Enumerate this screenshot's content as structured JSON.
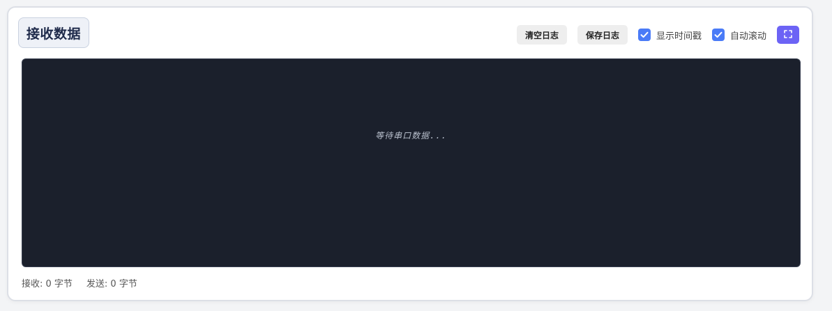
{
  "panel": {
    "title": "接收数据"
  },
  "toolbar": {
    "clear_label": "清空日志",
    "save_label": "保存日志",
    "timestamp_label": "显示时间戳",
    "timestamp_checked": true,
    "autoscroll_label": "自动滚动",
    "autoscroll_checked": true,
    "expand_icon": "fullscreen-icon"
  },
  "terminal": {
    "placeholder": "等待串口数据..."
  },
  "stats": {
    "received": "接收: 0 字节",
    "sent": "发送: 0 字节"
  },
  "colors": {
    "accent_checkbox": "#4a7bf7",
    "accent_expand": "#6c63f5",
    "terminal_bg": "#1b202c"
  }
}
